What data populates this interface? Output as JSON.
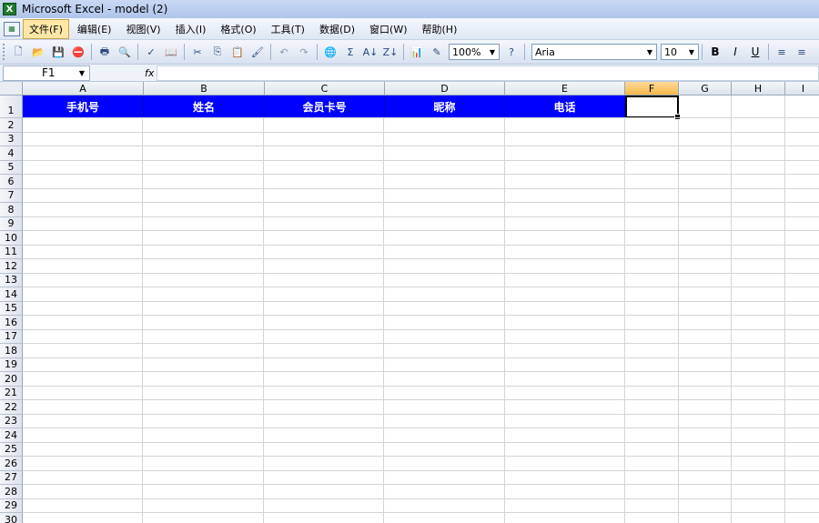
{
  "window": {
    "title": "Microsoft Excel - model (2)"
  },
  "menu": {
    "items": [
      {
        "label": "文件(F)",
        "active": true
      },
      {
        "label": "编辑(E)"
      },
      {
        "label": "视图(V)"
      },
      {
        "label": "插入(I)"
      },
      {
        "label": "格式(O)"
      },
      {
        "label": "工具(T)"
      },
      {
        "label": "数据(D)"
      },
      {
        "label": "窗口(W)"
      },
      {
        "label": "帮助(H)"
      }
    ]
  },
  "toolbar": {
    "zoom": "100%",
    "font": "Aria",
    "font_size": "10",
    "bold": "B",
    "italic": "I",
    "underline": "U",
    "sum": "Σ"
  },
  "formula_bar": {
    "name_box": "F1",
    "fx": "fx",
    "content": ""
  },
  "sheet": {
    "columns": [
      "A",
      "B",
      "C",
      "D",
      "E",
      "F",
      "G",
      "H",
      "I"
    ],
    "selected_column": "F",
    "rows": [
      "1",
      "2",
      "3",
      "4",
      "5",
      "6",
      "7",
      "8",
      "9",
      "10",
      "11",
      "12",
      "13",
      "14",
      "15",
      "16",
      "17",
      "18",
      "19",
      "20",
      "21",
      "22",
      "23",
      "24",
      "25",
      "26",
      "27",
      "28",
      "29",
      "30"
    ],
    "header_row": [
      "手机号",
      "姓名",
      "会员卡号",
      "昵称",
      "电话"
    ],
    "header_fill": "#0000ff",
    "header_text_color": "#ffffff",
    "active_cell": "F1"
  }
}
